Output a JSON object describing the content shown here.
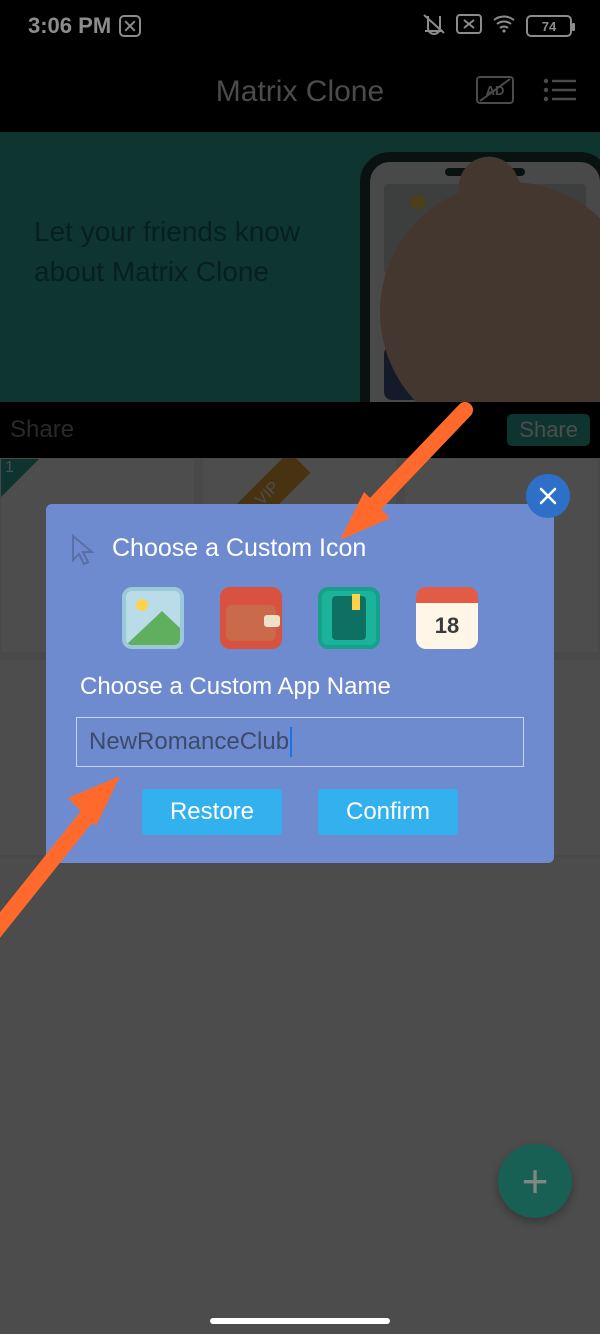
{
  "status": {
    "time": "3:06 PM",
    "battery": "74"
  },
  "header": {
    "title": "Matrix Clone"
  },
  "banner": {
    "line1": "Let your friends know",
    "line2": "about Matrix Clone"
  },
  "sharebar": {
    "label": "Share",
    "button": "Share"
  },
  "grid": {
    "tile1_badge": "1",
    "tile2_ribbon": "VIP"
  },
  "dialog": {
    "title_icon": "Choose a Custom Icon",
    "title_name": "Choose a Custom App Name",
    "input_value": "NewRomanceClub",
    "restore": "Restore",
    "confirm": "Confirm",
    "cal_day": "18"
  },
  "fab": {
    "plus": "+"
  }
}
